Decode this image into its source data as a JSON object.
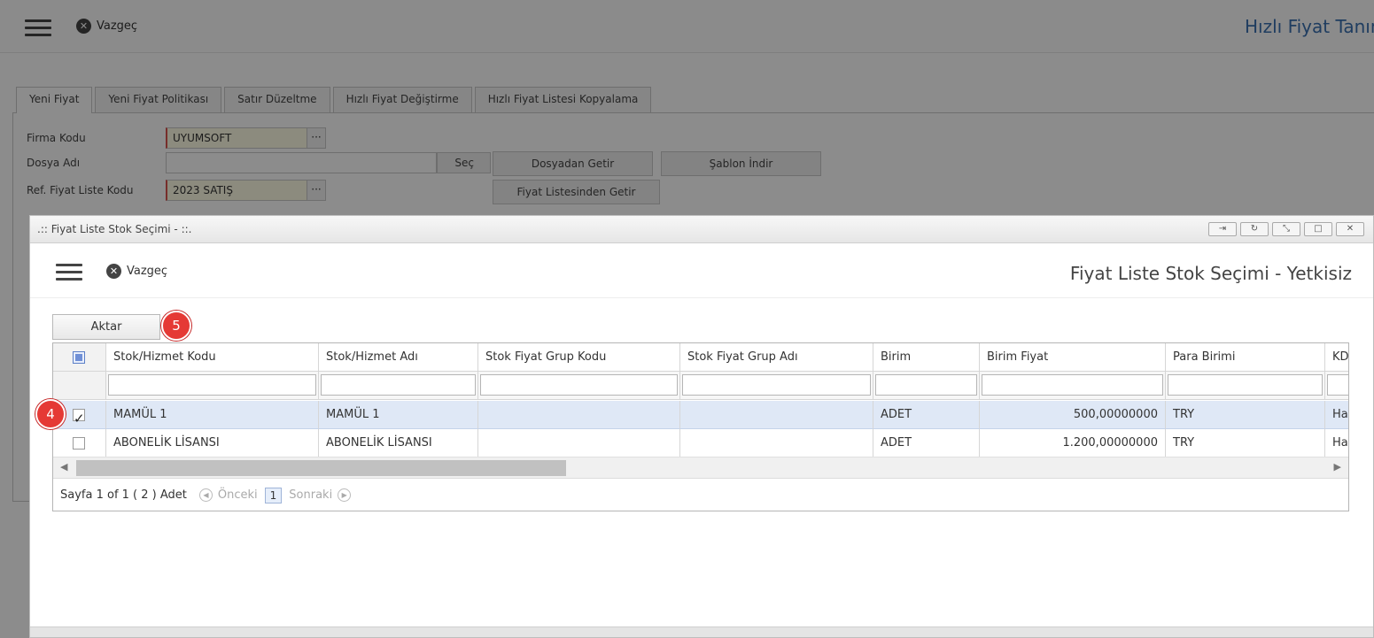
{
  "background": {
    "header": {
      "cancel_label": "Vazgeç",
      "title": "Hızlı Fiyat Tanım"
    },
    "tabs": [
      "Yeni Fiyat",
      "Yeni Fiyat Politikası",
      "Satır Düzeltme",
      "Hızlı Fiyat Değiştirme",
      "Hızlı Fiyat Listesi Kopyalama"
    ],
    "form": {
      "firma_kodu_label": "Firma Kodu",
      "firma_kodu_value": "UYUMSOFT",
      "dosya_adi_label": "Dosya Adı",
      "dosya_adi_value": "",
      "ref_label": "Ref. Fiyat Liste Kodu",
      "ref_value": "2023 SATIŞ",
      "dots": "···",
      "sec_label": "Seç",
      "dosyadan_getir_label": "Dosyadan Getir",
      "sablon_indir_label": "Şablon İndir",
      "fiyat_listesinden_getir_label": "Fiyat Listesinden Getir"
    }
  },
  "modal": {
    "caption": ".:: Fiyat Liste Stok Seçimi - ::.",
    "window_buttons": [
      "⇥",
      "↻",
      "⤡",
      "□",
      "✕"
    ],
    "cancel_label": "Vazgeç",
    "title": "Fiyat Liste Stok Seçimi - Yetkisiz",
    "aktar_label": "Aktar",
    "badge_aktar": "5",
    "badge_row": "4",
    "grid": {
      "columns": [
        "Stok/Hizmet Kodu",
        "Stok/Hizmet Adı",
        "Stok Fiyat Grup Kodu",
        "Stok Fiyat Grup Adı",
        "Birim",
        "Birim Fiyat",
        "Para Birimi",
        "KD"
      ],
      "rows": [
        {
          "checked": true,
          "kod": "MAMÜL 1",
          "ad": "MAMÜL 1",
          "grup_kodu": "",
          "grup_adi": "",
          "birim": "ADET",
          "birim_fiyat": "500,00000000",
          "para_birimi": "TRY",
          "kd": "Ha"
        },
        {
          "checked": false,
          "kod": "ABONELİK LİSANSI",
          "ad": "ABONELİK LİSANSI",
          "grup_kodu": "",
          "grup_adi": "",
          "birim": "ADET",
          "birim_fiyat": "1.200,00000000",
          "para_birimi": "TRY",
          "kd": "Ha"
        }
      ]
    },
    "pager": {
      "summary": "Sayfa 1 of 1 ( 2 ) Adet",
      "prev_label": "Önceki",
      "page": "1",
      "next_label": "Sonraki"
    }
  }
}
